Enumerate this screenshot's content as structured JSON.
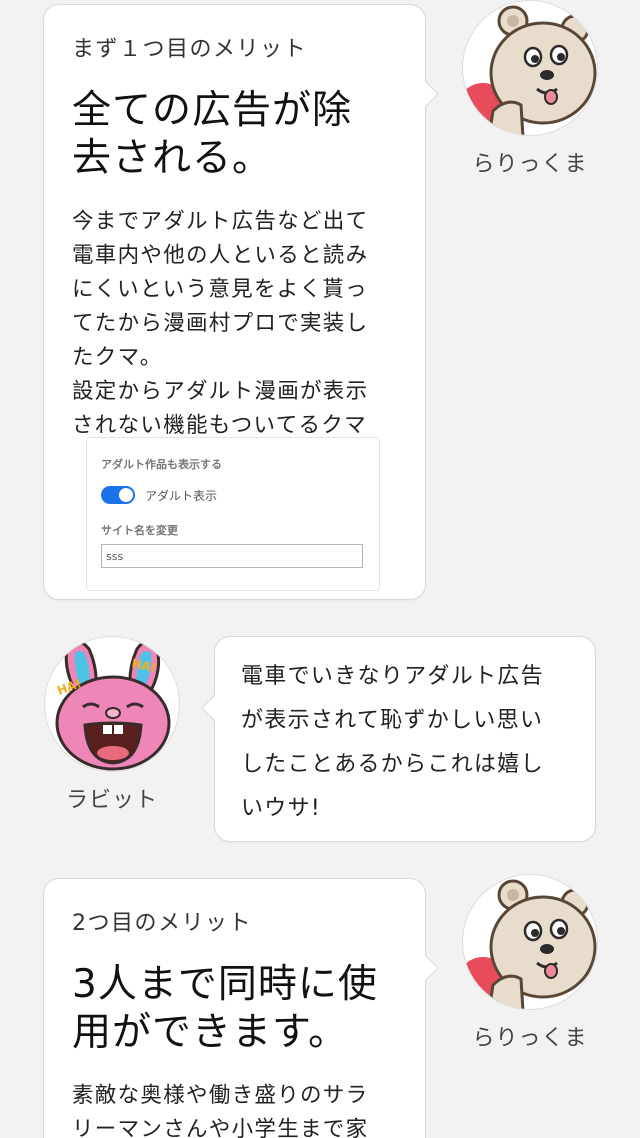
{
  "block1": {
    "lead": "まず１つ目のメリット",
    "heading_line1": "全ての広告が除",
    "heading_line2": "去される。",
    "body_lines": [
      "今までアダルト広告など出て",
      "電車内や他の人といると読み",
      "にくいという意見をよく貰っ",
      "てたから漫画村プロで実装し",
      "たクマ。",
      "設定からアダルト漫画が表示",
      "されない機能もついてるクマ"
    ],
    "settings": {
      "adult_label": "アダルト作品も表示する",
      "toggle_label": "アダルト表示",
      "toggle_on": true,
      "site_name_label": "サイト名を変更",
      "site_name_value": "sss"
    },
    "speaker_name": "らりっくま"
  },
  "block2": {
    "speaker_name": "ラビット",
    "avatar_text": "HA!",
    "lines": [
      "電車でいきなりアダルト広告",
      "が表示されて恥ずかしい思い",
      "したことあるからこれは嬉し",
      "いウサ!"
    ]
  },
  "block3": {
    "lead": "2つ目のメリット",
    "heading_line1": "3人まで同時に使",
    "heading_line2": "用ができます。",
    "body_lines": [
      "素敵な奥様や働き盛りのサラ",
      "リーマンさんや小学生まで家"
    ],
    "speaker_name": "らりっくま"
  },
  "colors": {
    "background": "#f2f2f2",
    "bubble": "#ffffff",
    "toggle": "#1a73e8",
    "bunny_pink": "#ee86b8",
    "bunny_blue": "#4fc3e6",
    "bear_fur": "#e8dccd"
  },
  "icons": [
    "bear-avatar-icon",
    "rabbit-avatar-icon",
    "toggle-switch-icon"
  ]
}
